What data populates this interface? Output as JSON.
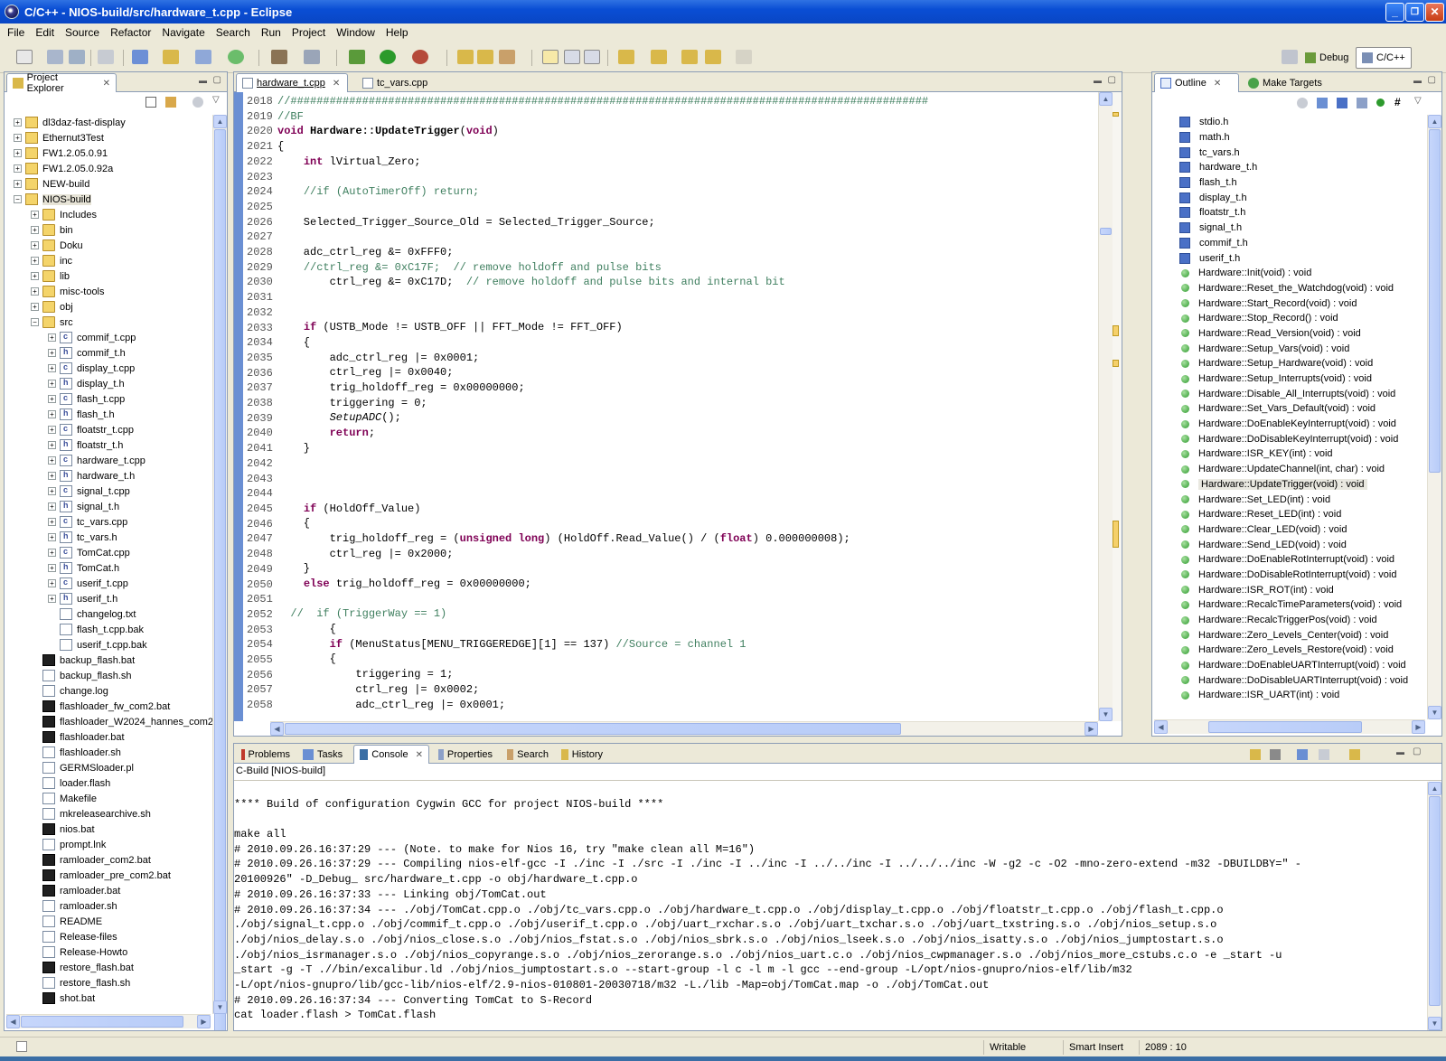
{
  "window": {
    "title": "C/C++ - NIOS-build/src/hardware_t.cpp - Eclipse"
  },
  "menu": [
    "File",
    "Edit",
    "Source",
    "Refactor",
    "Navigate",
    "Search",
    "Run",
    "Project",
    "Window",
    "Help"
  ],
  "perspectives": {
    "debug": "Debug",
    "cpp": "C/C++"
  },
  "project_explorer": {
    "title": "Project Explorer",
    "items": [
      {
        "label": "dl3daz-fast-display",
        "indent": 0,
        "type": "proj",
        "exp": "+"
      },
      {
        "label": "Ethernut3Test",
        "indent": 0,
        "type": "proj",
        "exp": "+"
      },
      {
        "label": "FW1.2.05.0.91",
        "indent": 0,
        "type": "proj",
        "exp": "+"
      },
      {
        "label": "FW1.2.05.0.92a",
        "indent": 0,
        "type": "proj",
        "exp": "+"
      },
      {
        "label": "NEW-build",
        "indent": 0,
        "type": "proj",
        "exp": "+"
      },
      {
        "label": "NIOS-build",
        "indent": 0,
        "type": "proj",
        "exp": "-"
      },
      {
        "label": "Includes",
        "indent": 1,
        "type": "folder",
        "exp": "+"
      },
      {
        "label": "bin",
        "indent": 1,
        "type": "folder",
        "exp": "+"
      },
      {
        "label": "Doku",
        "indent": 1,
        "type": "folder",
        "exp": "+"
      },
      {
        "label": "inc",
        "indent": 1,
        "type": "folder",
        "exp": "+"
      },
      {
        "label": "lib",
        "indent": 1,
        "type": "folder",
        "exp": "+"
      },
      {
        "label": "misc-tools",
        "indent": 1,
        "type": "folder",
        "exp": "+"
      },
      {
        "label": "obj",
        "indent": 1,
        "type": "folder",
        "exp": "+"
      },
      {
        "label": "src",
        "indent": 1,
        "type": "folder",
        "exp": "-"
      },
      {
        "label": "commif_t.cpp",
        "indent": 2,
        "type": "cfile",
        "exp": "+"
      },
      {
        "label": "commif_t.h",
        "indent": 2,
        "type": "hfile",
        "exp": "+"
      },
      {
        "label": "display_t.cpp",
        "indent": 2,
        "type": "cfile",
        "exp": "+"
      },
      {
        "label": "display_t.h",
        "indent": 2,
        "type": "hfile",
        "exp": "+"
      },
      {
        "label": "flash_t.cpp",
        "indent": 2,
        "type": "cfile",
        "exp": "+"
      },
      {
        "label": "flash_t.h",
        "indent": 2,
        "type": "hfile",
        "exp": "+"
      },
      {
        "label": "floatstr_t.cpp",
        "indent": 2,
        "type": "cfile",
        "exp": "+"
      },
      {
        "label": "floatstr_t.h",
        "indent": 2,
        "type": "hfile",
        "exp": "+"
      },
      {
        "label": "hardware_t.cpp",
        "indent": 2,
        "type": "cfile",
        "exp": "+"
      },
      {
        "label": "hardware_t.h",
        "indent": 2,
        "type": "hfile",
        "exp": "+"
      },
      {
        "label": "signal_t.cpp",
        "indent": 2,
        "type": "cfile",
        "exp": "+"
      },
      {
        "label": "signal_t.h",
        "indent": 2,
        "type": "hfile",
        "exp": "+"
      },
      {
        "label": "tc_vars.cpp",
        "indent": 2,
        "type": "cfile",
        "exp": "+"
      },
      {
        "label": "tc_vars.h",
        "indent": 2,
        "type": "hfile",
        "exp": "+"
      },
      {
        "label": "TomCat.cpp",
        "indent": 2,
        "type": "cfile",
        "exp": "+"
      },
      {
        "label": "TomCat.h",
        "indent": 2,
        "type": "hfile",
        "exp": "+"
      },
      {
        "label": "userif_t.cpp",
        "indent": 2,
        "type": "cfile",
        "exp": "+"
      },
      {
        "label": "userif_t.h",
        "indent": 2,
        "type": "hfile",
        "exp": "+"
      },
      {
        "label": "changelog.txt",
        "indent": 2,
        "type": "tfile",
        "exp": ""
      },
      {
        "label": "flash_t.cpp.bak",
        "indent": 2,
        "type": "tfile",
        "exp": ""
      },
      {
        "label": "userif_t.cpp.bak",
        "indent": 2,
        "type": "tfile",
        "exp": ""
      },
      {
        "label": "backup_flash.bat",
        "indent": 1,
        "type": "bfile",
        "exp": ""
      },
      {
        "label": "backup_flash.sh",
        "indent": 1,
        "type": "tfile",
        "exp": ""
      },
      {
        "label": "change.log",
        "indent": 1,
        "type": "tfile",
        "exp": ""
      },
      {
        "label": "flashloader_fw_com2.bat",
        "indent": 1,
        "type": "bfile",
        "exp": ""
      },
      {
        "label": "flashloader_W2024_hannes_com2.",
        "indent": 1,
        "type": "bfile",
        "exp": ""
      },
      {
        "label": "flashloader.bat",
        "indent": 1,
        "type": "bfile",
        "exp": ""
      },
      {
        "label": "flashloader.sh",
        "indent": 1,
        "type": "tfile",
        "exp": ""
      },
      {
        "label": "GERMSloader.pl",
        "indent": 1,
        "type": "tfile",
        "exp": ""
      },
      {
        "label": "loader.flash",
        "indent": 1,
        "type": "tfile",
        "exp": ""
      },
      {
        "label": "Makefile",
        "indent": 1,
        "type": "tfile",
        "exp": ""
      },
      {
        "label": "mkreleasearchive.sh",
        "indent": 1,
        "type": "tfile",
        "exp": ""
      },
      {
        "label": "nios.bat",
        "indent": 1,
        "type": "bfile",
        "exp": ""
      },
      {
        "label": "prompt.lnk",
        "indent": 1,
        "type": "tfile",
        "exp": ""
      },
      {
        "label": "ramloader_com2.bat",
        "indent": 1,
        "type": "bfile",
        "exp": ""
      },
      {
        "label": "ramloader_pre_com2.bat",
        "indent": 1,
        "type": "bfile",
        "exp": ""
      },
      {
        "label": "ramloader.bat",
        "indent": 1,
        "type": "bfile",
        "exp": ""
      },
      {
        "label": "ramloader.sh",
        "indent": 1,
        "type": "tfile",
        "exp": ""
      },
      {
        "label": "README",
        "indent": 1,
        "type": "tfile",
        "exp": ""
      },
      {
        "label": "Release-files",
        "indent": 1,
        "type": "tfile",
        "exp": ""
      },
      {
        "label": "Release-Howto",
        "indent": 1,
        "type": "tfile",
        "exp": ""
      },
      {
        "label": "restore_flash.bat",
        "indent": 1,
        "type": "bfile",
        "exp": ""
      },
      {
        "label": "restore_flash.sh",
        "indent": 1,
        "type": "tfile",
        "exp": ""
      },
      {
        "label": "shot.bat",
        "indent": 1,
        "type": "bfile",
        "exp": ""
      }
    ]
  },
  "editor": {
    "tabs": [
      {
        "label": "hardware_t.cpp",
        "active": true
      },
      {
        "label": "tc_vars.cpp",
        "active": false
      }
    ],
    "line_numbers": [
      "2018",
      "2019",
      "2020",
      "2021",
      "2022",
      "2023",
      "2024",
      "2025",
      "2026",
      "2027",
      "2028",
      "2029",
      "2030",
      "2031",
      "2032",
      "2033",
      "2034",
      "2035",
      "2036",
      "2037",
      "2038",
      "2039",
      "2040",
      "2041",
      "2042",
      "2043",
      "2044",
      "2045",
      "2046",
      "2047",
      "2048",
      "2049",
      "2050",
      "2051",
      "2052",
      "2053",
      "2054",
      "2055",
      "2056",
      "2057",
      "2058"
    ],
    "lines": [
      [
        {
          "t": "//##################################################################################################",
          "c": "cm"
        }
      ],
      [
        {
          "t": "//BF",
          "c": "cm"
        }
      ],
      [
        {
          "t": "void ",
          "c": "kw"
        },
        {
          "t": "Hardware::UpdateTrigger",
          "c": "fn"
        },
        {
          "t": "("
        },
        {
          "t": "void",
          "c": "kw"
        },
        {
          "t": ")"
        }
      ],
      [
        {
          "t": "{"
        }
      ],
      [
        {
          "t": "    "
        },
        {
          "t": "int",
          "c": "kw"
        },
        {
          "t": " lVirtual_Zero;"
        }
      ],
      [
        {
          "t": ""
        }
      ],
      [
        {
          "t": "    "
        },
        {
          "t": "//if (AutoTimerOff) return;",
          "c": "cm"
        }
      ],
      [
        {
          "t": ""
        }
      ],
      [
        {
          "t": "    Selected_Trigger_Source_Old = Selected_Trigger_Source;"
        }
      ],
      [
        {
          "t": ""
        }
      ],
      [
        {
          "t": "    adc_ctrl_reg &= 0xFFF0;"
        }
      ],
      [
        {
          "t": "    "
        },
        {
          "t": "//ctrl_reg &= 0xC17F;  // remove holdoff and pulse bits",
          "c": "cm"
        }
      ],
      [
        {
          "t": "        ctrl_reg &= 0xC17D;  "
        },
        {
          "t": "// remove holdoff and pulse bits and internal bit",
          "c": "cm"
        }
      ],
      [
        {
          "t": ""
        }
      ],
      [
        {
          "t": ""
        }
      ],
      [
        {
          "t": "    "
        },
        {
          "t": "if",
          "c": "kw"
        },
        {
          "t": " (USTB_Mode != USTB_OFF || FFT_Mode != FFT_OFF)"
        }
      ],
      [
        {
          "t": "    {"
        }
      ],
      [
        {
          "t": "        adc_ctrl_reg |= 0x0001;"
        }
      ],
      [
        {
          "t": "        ctrl_reg |= 0x0040;"
        }
      ],
      [
        {
          "t": "        trig_holdoff_reg = 0x00000000;"
        }
      ],
      [
        {
          "t": "        triggering = 0;"
        }
      ],
      [
        {
          "t": "        "
        },
        {
          "t": "SetupADC",
          "c": "it"
        },
        {
          "t": "();"
        }
      ],
      [
        {
          "t": "        "
        },
        {
          "t": "return",
          "c": "kw"
        },
        {
          "t": ";"
        }
      ],
      [
        {
          "t": "    }"
        }
      ],
      [
        {
          "t": ""
        }
      ],
      [
        {
          "t": ""
        }
      ],
      [
        {
          "t": ""
        }
      ],
      [
        {
          "t": "    "
        },
        {
          "t": "if",
          "c": "kw"
        },
        {
          "t": " (HoldOff_Value)"
        }
      ],
      [
        {
          "t": "    {"
        }
      ],
      [
        {
          "t": "        trig_holdoff_reg = ("
        },
        {
          "t": "unsigned long",
          "c": "kw"
        },
        {
          "t": ") (HoldOff.Read_Value() / ("
        },
        {
          "t": "float",
          "c": "kw"
        },
        {
          "t": ") 0.000000008);"
        }
      ],
      [
        {
          "t": "        ctrl_reg |= 0x2000;"
        }
      ],
      [
        {
          "t": "    }"
        }
      ],
      [
        {
          "t": "    "
        },
        {
          "t": "else",
          "c": "kw"
        },
        {
          "t": " trig_holdoff_reg = 0x00000000;"
        }
      ],
      [
        {
          "t": ""
        }
      ],
      [
        {
          "t": "  "
        },
        {
          "t": "//  if (TriggerWay == 1)",
          "c": "cm"
        }
      ],
      [
        {
          "t": "        {"
        }
      ],
      [
        {
          "t": "        "
        },
        {
          "t": "if",
          "c": "kw"
        },
        {
          "t": " (MenuStatus[MENU_TRIGGEREDGE][1] == 137) "
        },
        {
          "t": "//Source = channel 1",
          "c": "cm"
        }
      ],
      [
        {
          "t": "        {"
        }
      ],
      [
        {
          "t": "            triggering = 1;"
        }
      ],
      [
        {
          "t": "            ctrl_reg |= 0x0002;"
        }
      ],
      [
        {
          "t": "            adc_ctrl_reg |= 0x0001;"
        }
      ]
    ]
  },
  "outline": {
    "tabs": {
      "outline": "Outline",
      "make_targets": "Make Targets"
    },
    "includes": [
      "stdio.h",
      "math.h",
      "tc_vars.h",
      "hardware_t.h",
      "flash_t.h",
      "display_t.h",
      "floatstr_t.h",
      "signal_t.h",
      "commif_t.h",
      "userif_t.h"
    ],
    "methods": [
      "Hardware::Init(void) : void",
      "Hardware::Reset_the_Watchdog(void) : void",
      "Hardware::Start_Record(void) : void",
      "Hardware::Stop_Record() : void",
      "Hardware::Read_Version(void) : void",
      "Hardware::Setup_Vars(void) : void",
      "Hardware::Setup_Hardware(void) : void",
      "Hardware::Setup_Interrupts(void) : void",
      "Hardware::Disable_All_Interrupts(void) : void",
      "Hardware::Set_Vars_Default(void) : void",
      "Hardware::DoEnableKeyInterrupt(void) : void",
      "Hardware::DoDisableKeyInterrupt(void) : void",
      "Hardware::ISR_KEY(int) : void",
      "Hardware::UpdateChannel(int, char) : void",
      "Hardware::UpdateTrigger(void) : void",
      "Hardware::Set_LED(int) : void",
      "Hardware::Reset_LED(int) : void",
      "Hardware::Clear_LED(void) : void",
      "Hardware::Send_LED(void) : void",
      "Hardware::DoEnableRotInterrupt(void) : void",
      "Hardware::DoDisableRotInterrupt(void) : void",
      "Hardware::ISR_ROT(int) : void",
      "Hardware::RecalcTimeParameters(void) : void",
      "Hardware::RecalcTriggerPos(void) : void",
      "Hardware::Zero_Levels_Center(void) : void",
      "Hardware::Zero_Levels_Restore(void) : void",
      "Hardware::DoEnableUARTInterrupt(void) : void",
      "Hardware::DoDisableUARTInterrupt(void) : void",
      "Hardware::ISR_UART(int) : void"
    ],
    "selected": "Hardware::UpdateTrigger(void) : void"
  },
  "bottom": {
    "tabs": [
      "Problems",
      "Tasks",
      "Console",
      "Properties",
      "Search",
      "History"
    ],
    "active_tab": "Console",
    "console_title": "C-Build [NIOS-build]",
    "lines": [
      "",
      "**** Build of configuration Cygwin GCC for project NIOS-build ****",
      "",
      "make all",
      "# 2010.09.26.16:37:29 --- (Note. to make for Nios 16, try \"make clean all M=16\")",
      "# 2010.09.26.16:37:29 --- Compiling nios-elf-gcc -I ./inc -I ./src -I ./inc -I ../inc -I ../../inc -I ../../../inc -W -g2 -c -O2 -mno-zero-extend -m32 -DBUILDBY=\" -",
      "20100926\" -D_Debug_ src/hardware_t.cpp -o obj/hardware_t.cpp.o",
      "# 2010.09.26.16:37:33 --- Linking obj/TomCat.out",
      "# 2010.09.26.16:37:34 --- ./obj/TomCat.cpp.o ./obj/tc_vars.cpp.o ./obj/hardware_t.cpp.o ./obj/display_t.cpp.o ./obj/floatstr_t.cpp.o ./obj/flash_t.cpp.o",
      "./obj/signal_t.cpp.o ./obj/commif_t.cpp.o ./obj/userif_t.cpp.o ./obj/uart_rxchar.s.o ./obj/uart_txchar.s.o ./obj/uart_txstring.s.o ./obj/nios_setup.s.o",
      "./obj/nios_delay.s.o ./obj/nios_close.s.o ./obj/nios_fstat.s.o ./obj/nios_sbrk.s.o ./obj/nios_lseek.s.o ./obj/nios_isatty.s.o ./obj/nios_jumptostart.s.o",
      "./obj/nios_isrmanager.s.o ./obj/nios_copyrange.s.o ./obj/nios_zerorange.s.o ./obj/nios_uart.c.o ./obj/nios_cwpmanager.s.o ./obj/nios_more_cstubs.c.o -e _start -u",
      "_start -g -T .//bin/excalibur.ld ./obj/nios_jumptostart.s.o --start-group -l c -l m -l gcc --end-group -L/opt/nios-gnupro/nios-elf/lib/m32",
      "-L/opt/nios-gnupro/lib/gcc-lib/nios-elf/2.9-nios-010801-20030718/m32 -L./lib -Map=obj/TomCat.map -o ./obj/TomCat.out",
      "# 2010.09.26.16:37:34 --- Converting TomCat to S-Record",
      "cat loader.flash > TomCat.flash"
    ]
  },
  "status": {
    "writable": "Writable",
    "insert": "Smart Insert",
    "position": "2089 : 10"
  }
}
